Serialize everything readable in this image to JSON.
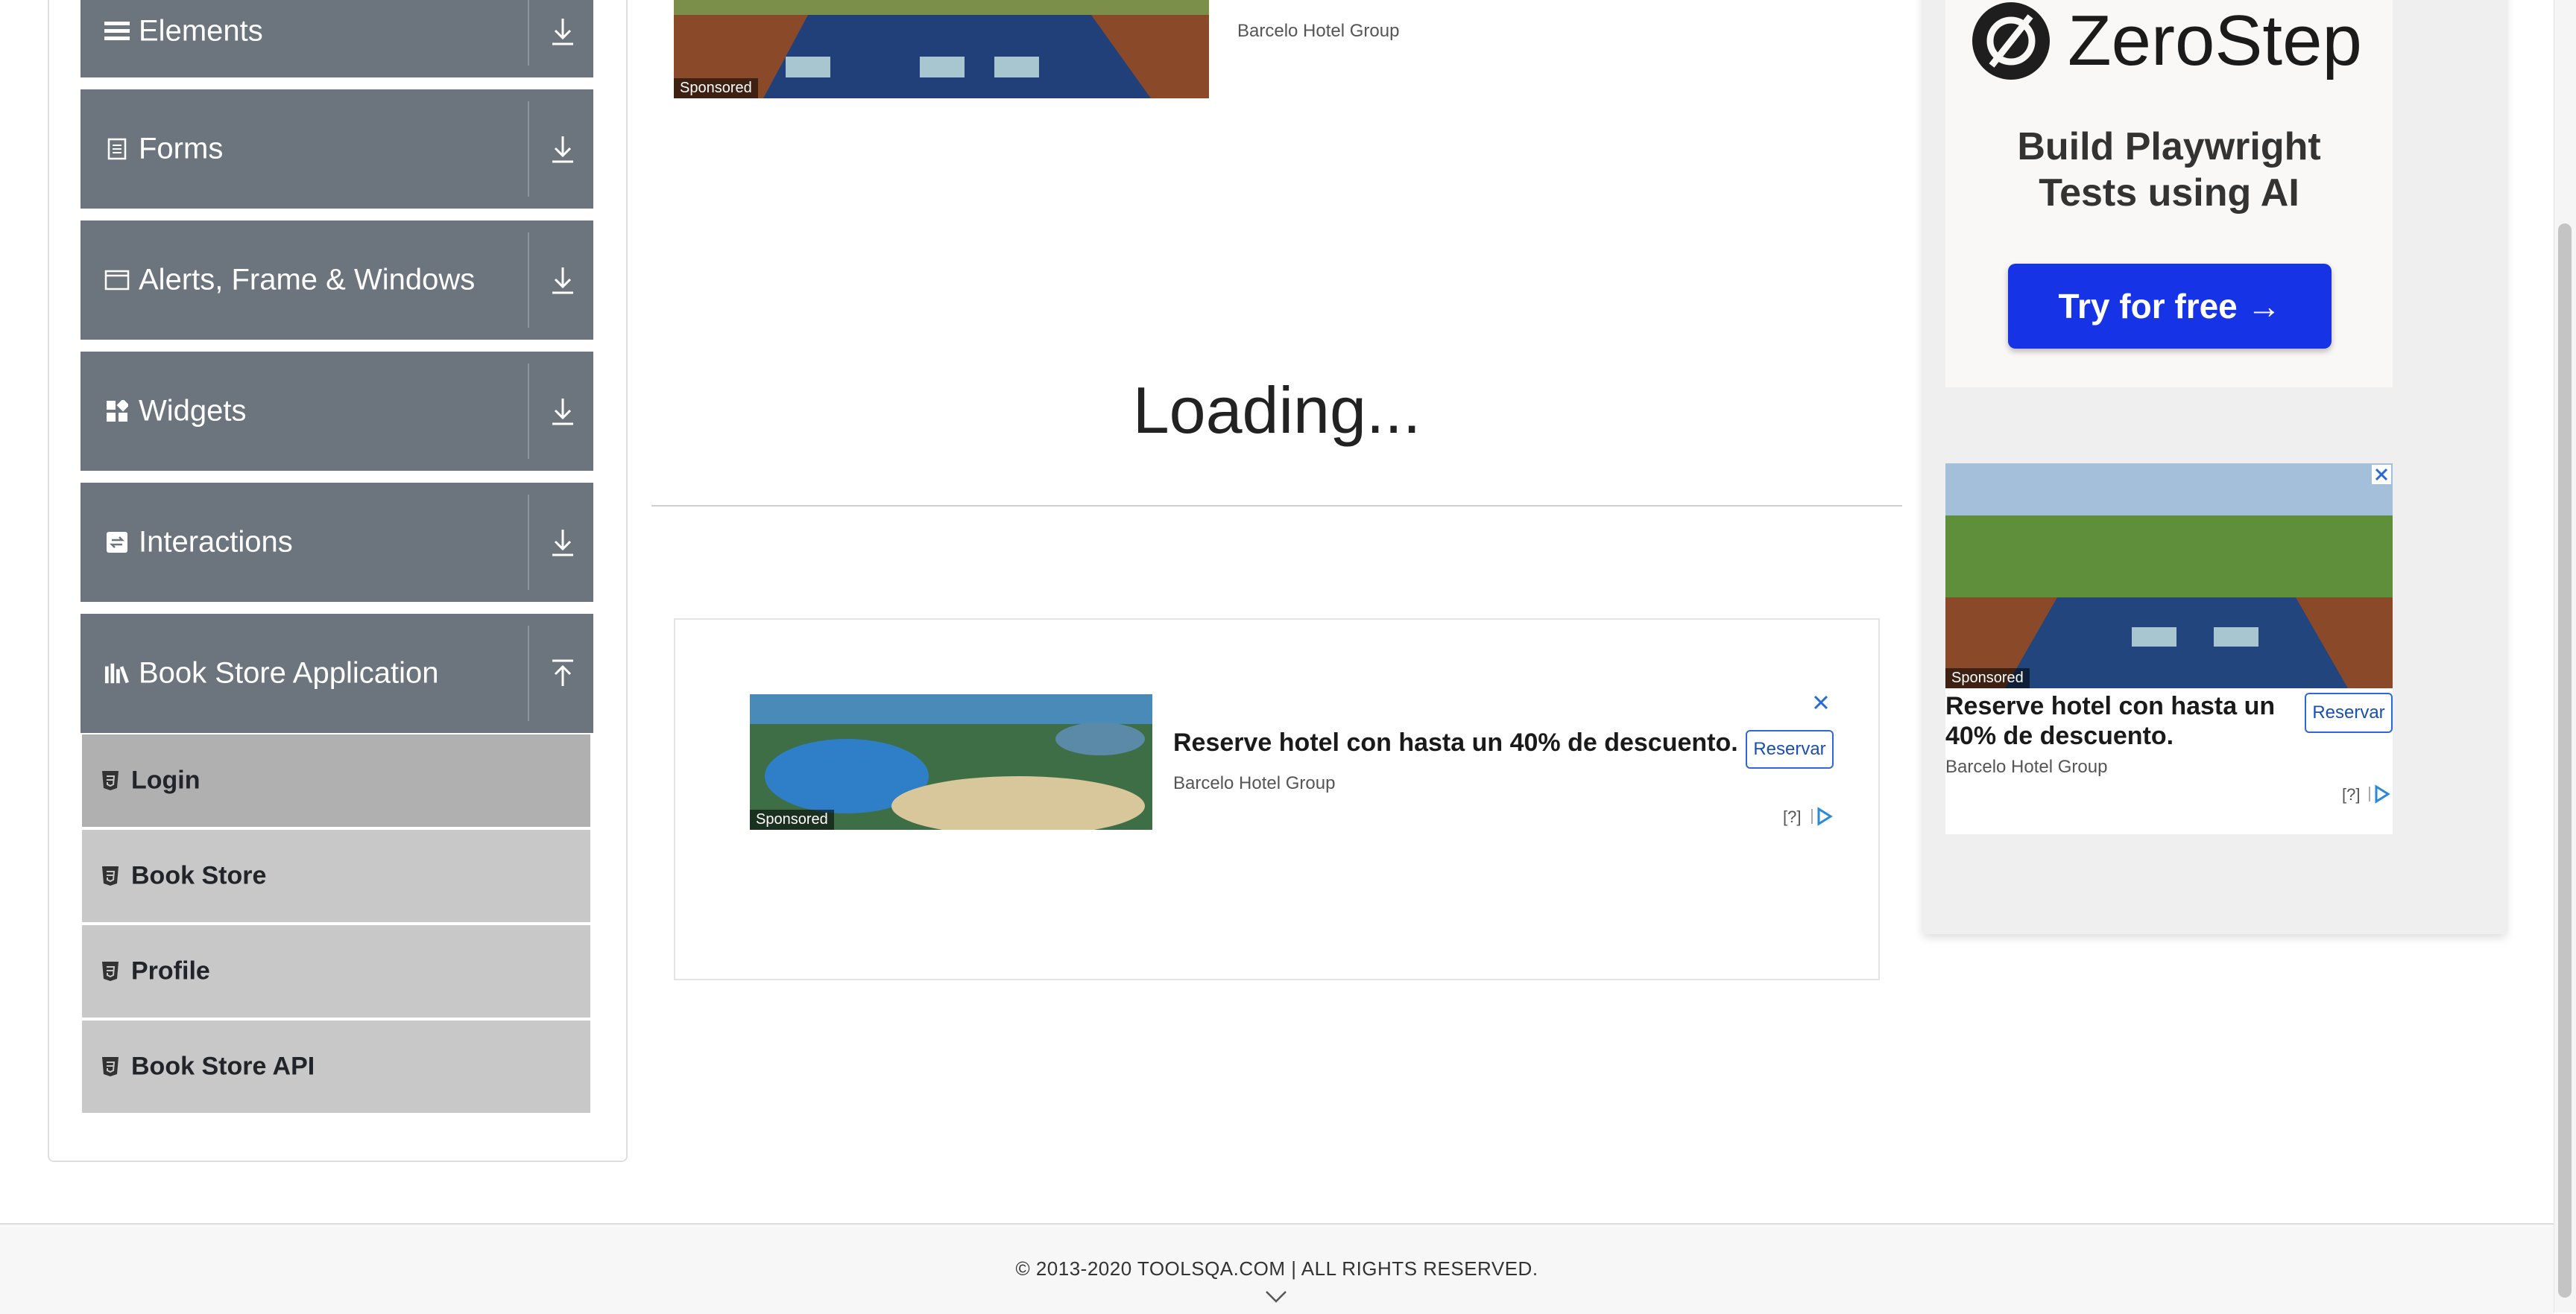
{
  "sidebar": {
    "groups": [
      {
        "label": "Elements",
        "icon": "list-icon",
        "toggle": "expand-icon"
      },
      {
        "label": "Forms",
        "icon": "document-icon",
        "toggle": "expand-icon"
      },
      {
        "label": "Alerts, Frame & Windows",
        "icon": "window-icon",
        "toggle": "expand-icon"
      },
      {
        "label": "Widgets",
        "icon": "grid-icon",
        "toggle": "expand-icon"
      },
      {
        "label": "Interactions",
        "icon": "interaction-icon",
        "toggle": "expand-icon"
      },
      {
        "label": "Book Store Application",
        "icon": "books-icon",
        "toggle": "collapse-icon"
      }
    ],
    "book_store_items": [
      {
        "label": "Login",
        "active": true
      },
      {
        "label": "Book Store",
        "active": false
      },
      {
        "label": "Profile",
        "active": false
      },
      {
        "label": "Book Store API",
        "active": false
      }
    ]
  },
  "main": {
    "top_ad": {
      "sponsored": "Sponsored",
      "advertiser": "Barcelo Hotel Group"
    },
    "loading_text": "Loading...",
    "ad": {
      "sponsored": "Sponsored",
      "headline": "Reserve hotel con hasta un 40% de descuento.",
      "advertiser": "Barcelo Hotel Group",
      "cta": "Reservar",
      "info": "[?]"
    }
  },
  "right_column": {
    "zerostep": {
      "name": "ZeroStep",
      "tagline_line1": "Build Playwright",
      "tagline_line2": "Tests using AI",
      "button": "Try for free →"
    },
    "side_ad": {
      "sponsored": "Sponsored",
      "headline": "Reserve hotel con hasta un 40% de descuento.",
      "advertiser": "Barcelo Hotel Group",
      "cta": "Reservar",
      "info": "[?]"
    }
  },
  "footer": {
    "text": "© 2013-2020 TOOLSQA.COM | ALL RIGHTS RESERVED."
  },
  "colors": {
    "sidebar_header_bg": "#6c757d",
    "sidebar_item_bg": "#c8c8c8",
    "sidebar_item_active_bg": "#b0b0b0",
    "cta_blue": "#1633e6",
    "ad_border_blue": "#2a6ad6"
  }
}
